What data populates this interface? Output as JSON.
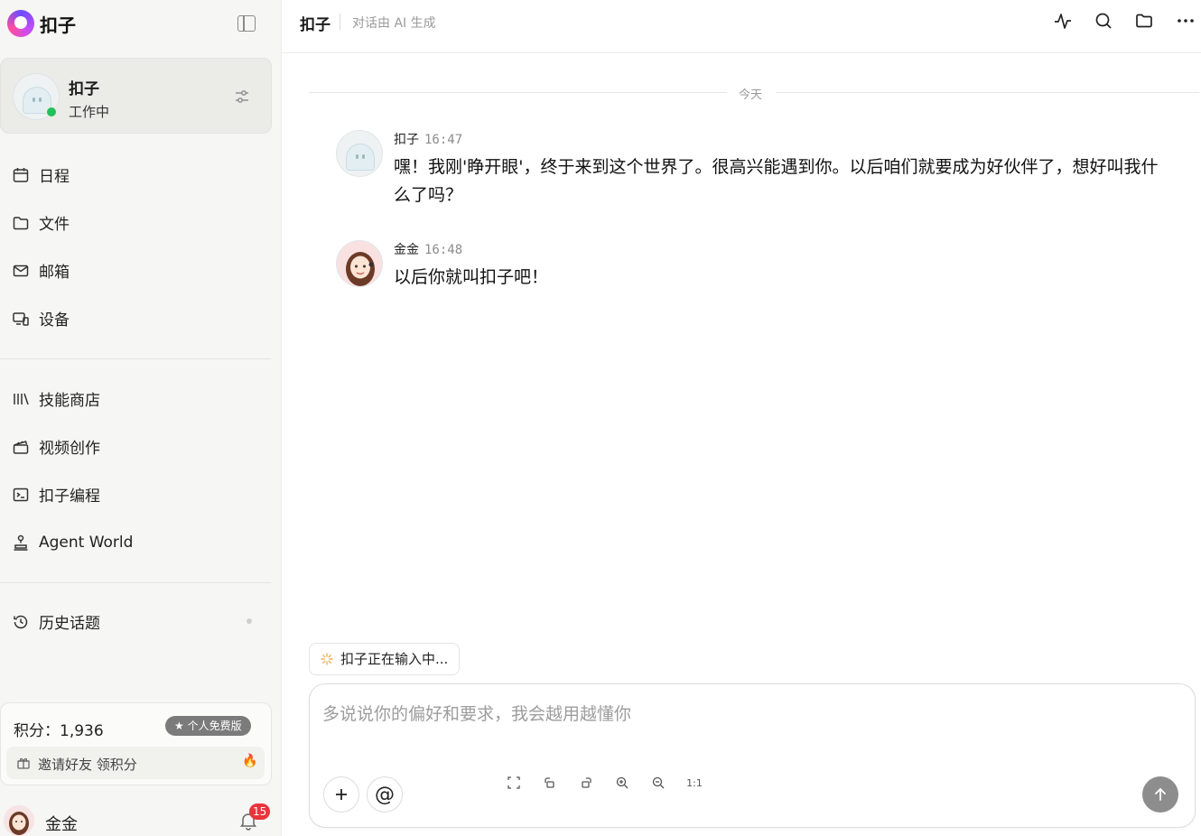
{
  "brand": {
    "name": "扣子"
  },
  "agent": {
    "name": "扣子",
    "status": "工作中"
  },
  "nav_primary": [
    {
      "label": "日程",
      "icon": "calendar-icon"
    },
    {
      "label": "文件",
      "icon": "folder-icon"
    },
    {
      "label": "邮箱",
      "icon": "mail-icon"
    },
    {
      "label": "设备",
      "icon": "devices-icon"
    }
  ],
  "nav_secondary": [
    {
      "label": "技能商店",
      "icon": "library-icon"
    },
    {
      "label": "视频创作",
      "icon": "clapper-icon"
    },
    {
      "label": "扣子编程",
      "icon": "terminal-icon"
    },
    {
      "label": "Agent World",
      "icon": "stamp-icon"
    }
  ],
  "nav_history": {
    "label": "历史话题",
    "icon": "history-icon"
  },
  "points": {
    "label": "积分：1,936",
    "plan": "个人免费版",
    "invite": "邀请好友 领积分"
  },
  "user": {
    "name": "金金",
    "notifications": "15"
  },
  "header": {
    "title": "扣子",
    "subtitle": "对话由 AI 生成"
  },
  "chat": {
    "date_divider": "今天",
    "messages": [
      {
        "sender": "扣子",
        "time": "16:47",
        "text": "嘿！我刚'睁开眼'，终于来到这个世界了。很高兴能遇到你。以后咱们就要成为好伙伴了，想好叫我什么了吗？"
      },
      {
        "sender": "金金",
        "time": "16:48",
        "text": "以后你就叫扣子吧！"
      }
    ]
  },
  "typing_indicator": "扣子正在输入中...",
  "composer": {
    "placeholder": "多说说你的偏好和要求，我会越用越懂你",
    "ratio_label": "1:1"
  },
  "colors": {
    "online": "#21c05a",
    "badge": "#e8343a",
    "send": "#8d8d8d"
  }
}
